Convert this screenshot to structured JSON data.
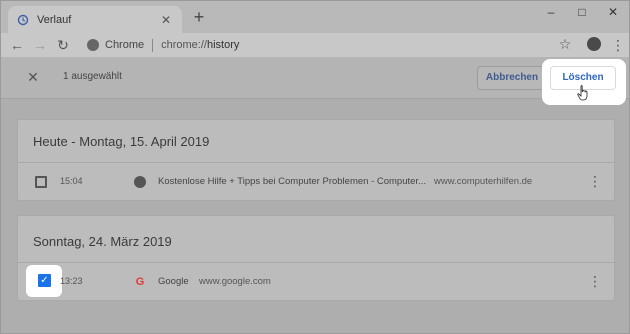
{
  "browser": {
    "tab_title": "Verlauf",
    "new_tab_symbol": "+",
    "omnibox": {
      "site_label": "Chrome",
      "url_prefix": "chrome://",
      "url_path": "history"
    }
  },
  "icons": {
    "history": "history-icon",
    "close": "close-icon",
    "back": "arrow-left-icon",
    "forward": "arrow-right-icon",
    "reload": "reload-icon",
    "star": "star-icon",
    "profile": "profile-icon",
    "menu": "more-vert-icon",
    "globe": "globe-icon",
    "google": "google-icon",
    "cursor": "hand-pointer-icon"
  },
  "selection_bar": {
    "count_label": "1 ausgewählt",
    "cancel_label": "Abbrechen",
    "delete_label": "Löschen"
  },
  "history": [
    {
      "date_label": "Heute - Montag, 15. April 2019",
      "entries": [
        {
          "time": "15:04",
          "title": "Kostenlose Hilfe + Tipps bei Computer Problemen - Computer...",
          "domain": "www.computerhilfen.de",
          "checked": false,
          "favicon": "globe"
        }
      ]
    },
    {
      "date_label": "Sonntag, 24. März 2019",
      "entries": [
        {
          "time": "13:23",
          "title": "Google",
          "domain": "www.google.com",
          "checked": true,
          "favicon": "google"
        }
      ]
    }
  ],
  "colors": {
    "accent": "#1a73e8",
    "delete_text": "#2d67c3",
    "cancel_text": "#3f5c8f"
  }
}
